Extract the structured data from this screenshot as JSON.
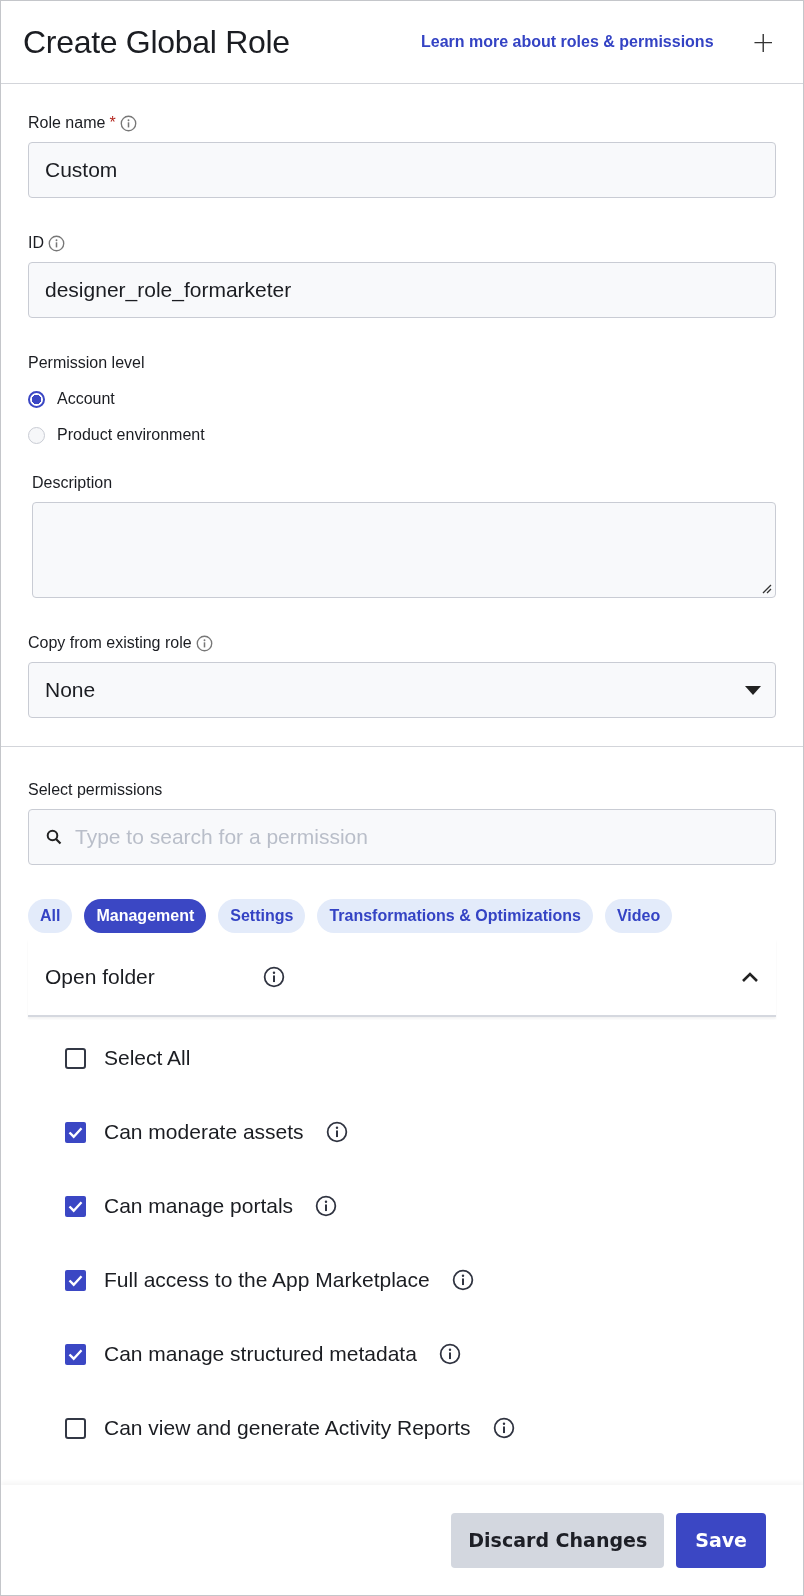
{
  "header": {
    "title": "Create Global Role",
    "help_link": "Learn more about roles & permissions",
    "close": "+"
  },
  "role_name": {
    "label": "Role name",
    "required": "*",
    "value": "Custom"
  },
  "id_field": {
    "label": "ID",
    "value": "designer_role_formarketer"
  },
  "permission_level": {
    "label": "Permission level",
    "options": [
      {
        "label": "Account",
        "selected": true
      },
      {
        "label": "Product environment",
        "selected": false
      }
    ]
  },
  "description": {
    "label": "Description"
  },
  "copy_from": {
    "label": "Copy from existing role",
    "value": "None"
  },
  "permissions": {
    "label": "Select permissions",
    "search_placeholder": "Type to search for a permission",
    "filters": [
      {
        "label": "All",
        "selected": false
      },
      {
        "label": "Management",
        "selected": true
      },
      {
        "label": "Settings",
        "selected": false
      },
      {
        "label": "Transformations & Optimizations",
        "selected": false
      },
      {
        "label": "Video",
        "selected": false
      }
    ],
    "folder": {
      "title": "Open folder",
      "expanded": true
    },
    "items": [
      {
        "label": "Select All",
        "checked": false,
        "info": false
      },
      {
        "label": "Can moderate assets",
        "checked": true,
        "info": true
      },
      {
        "label": "Can manage portals",
        "checked": true,
        "info": true
      },
      {
        "label": "Full access to the App Marketplace",
        "checked": true,
        "info": true
      },
      {
        "label": "Can manage structured metadata",
        "checked": true,
        "info": true
      },
      {
        "label": "Can view and generate Activity Reports",
        "checked": false,
        "info": true
      }
    ]
  },
  "footer": {
    "buttons": [
      {
        "label": "Discard Changes",
        "kind": "secondary"
      },
      {
        "label": "Save",
        "kind": "primary"
      }
    ]
  }
}
